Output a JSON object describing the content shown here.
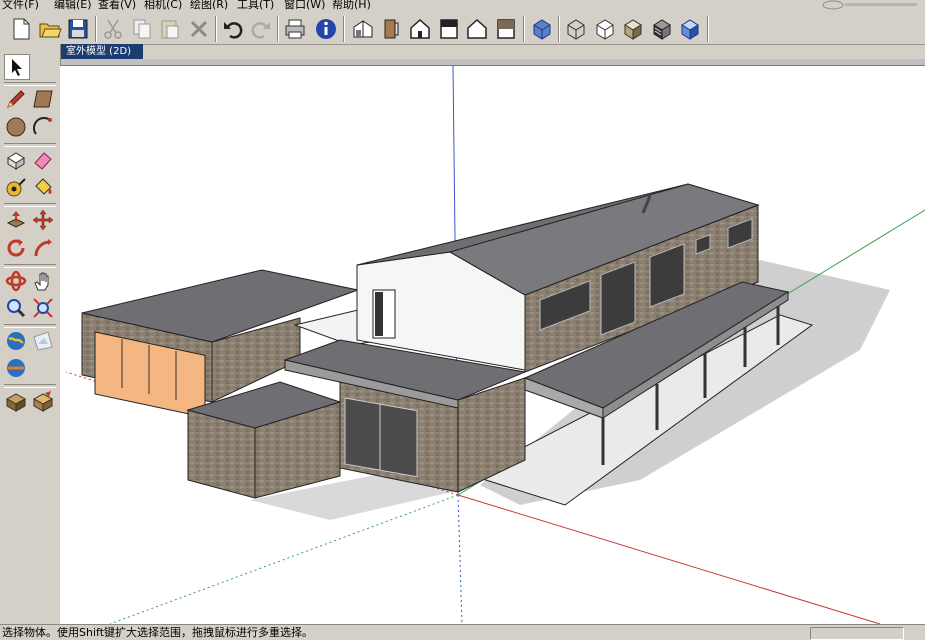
{
  "menu": [
    {
      "label": "文件(F)"
    },
    {
      "label": "编辑(E)"
    },
    {
      "label": "查看(V)"
    },
    {
      "label": "相机(C)"
    },
    {
      "label": "绘图(R)"
    },
    {
      "label": "工具(T)"
    },
    {
      "label": "窗口(W)"
    },
    {
      "label": "帮助(H)"
    }
  ],
  "toolbar": [
    {
      "icon": "new-file-icon"
    },
    {
      "icon": "open-folder-icon"
    },
    {
      "icon": "save-icon"
    },
    {
      "icon": "cut-icon"
    },
    {
      "icon": "copy-icon"
    },
    {
      "icon": "paste-icon"
    },
    {
      "icon": "delete-icon"
    },
    {
      "icon": "undo-icon"
    },
    {
      "icon": "redo-icon"
    },
    {
      "icon": "print-icon"
    },
    {
      "icon": "model-info-icon"
    },
    {
      "icon": "iso-view-icon"
    },
    {
      "icon": "top-view-icon"
    },
    {
      "icon": "front-view-icon"
    },
    {
      "icon": "right-view-icon"
    },
    {
      "icon": "back-view-icon"
    },
    {
      "icon": "left-view-icon"
    },
    {
      "icon": "xray-style-icon"
    },
    {
      "icon": "wireframe-style-icon"
    },
    {
      "icon": "hidden-line-style-icon"
    },
    {
      "icon": "shaded-style-icon"
    },
    {
      "icon": "shaded-texture-style-icon"
    },
    {
      "icon": "monochrome-style-icon"
    }
  ],
  "scene_tab": {
    "label": "室外模型 (2D)"
  },
  "tools": [
    {
      "icon": "select-arrow-icon"
    },
    {
      "icon": "pencil-line-icon"
    },
    {
      "icon": "rectangle-icon"
    },
    {
      "icon": "circle-icon"
    },
    {
      "icon": "arc-icon"
    },
    {
      "icon": "make-component-icon"
    },
    {
      "icon": "eraser-icon"
    },
    {
      "icon": "tape-measure-icon"
    },
    {
      "icon": "paint-bucket-icon"
    },
    {
      "icon": "push-pull-icon"
    },
    {
      "icon": "move-icon"
    },
    {
      "icon": "rotate-icon"
    },
    {
      "icon": "follow-me-icon"
    },
    {
      "icon": "orbit-icon"
    },
    {
      "icon": "pan-hand-icon"
    },
    {
      "icon": "zoom-icon"
    },
    {
      "icon": "zoom-extents-icon"
    },
    {
      "icon": "get-models-icon"
    },
    {
      "icon": "share-model-icon"
    },
    {
      "icon": "get-photo-texture-icon"
    },
    {
      "icon": "component-share-icon"
    },
    {
      "icon": "component-get-icon"
    }
  ],
  "status": {
    "text": "选择物体。使用Shift键扩大选择范围，拖拽鼠标进行多重选择。"
  },
  "colors": {
    "axis_red": "#c33a3a",
    "axis_green": "#3aa04a",
    "axis_blue": "#3a58c8",
    "roof": "#6f6e73",
    "wall_white": "#f6f6f4",
    "brick": "#8d8273",
    "glass_orange": "#f5b782",
    "tab_blue": "#1c3d72"
  }
}
